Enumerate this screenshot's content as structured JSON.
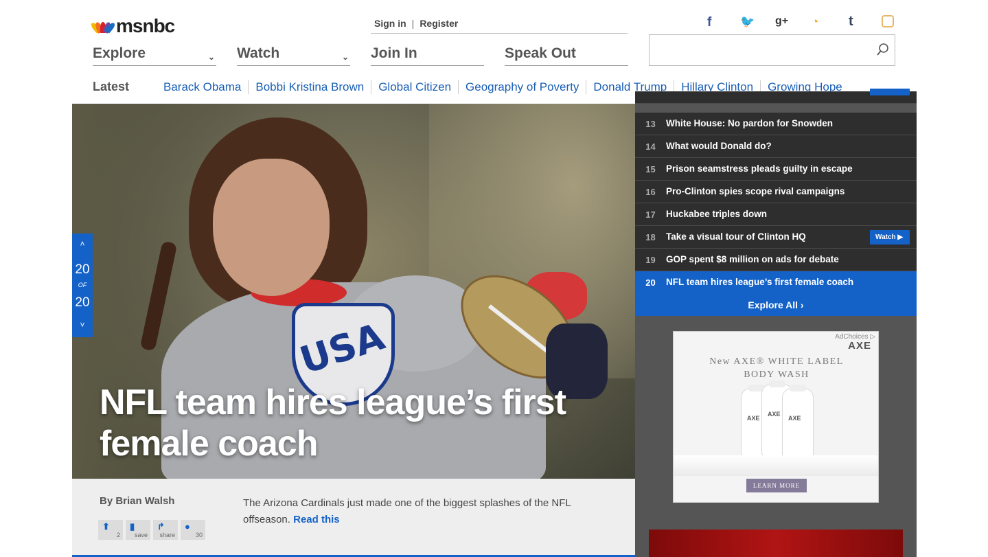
{
  "header": {
    "logo_text": "msnbc",
    "account": {
      "sign_in": "Sign in",
      "separator": "|",
      "register": "Register"
    },
    "nav": [
      {
        "label": "Explore",
        "has_dropdown": true
      },
      {
        "label": "Watch",
        "has_dropdown": true
      },
      {
        "label": "Join In",
        "has_dropdown": false
      },
      {
        "label": "Speak Out",
        "has_dropdown": false
      }
    ],
    "social": [
      "facebook-icon",
      "twitter-icon",
      "google-plus-icon",
      "rss-icon",
      "tumblr-icon",
      "instagram-icon"
    ],
    "search": {
      "value": "",
      "placeholder": ""
    }
  },
  "latest": {
    "label": "Latest",
    "links": [
      "Barack Obama",
      "Bobbi Kristina Brown",
      "Global Citizen",
      "Geography of Poverty",
      "Donald Trump",
      "Hillary Clinton",
      "Growing Hope"
    ]
  },
  "hero": {
    "headline": "NFL team hires league’s first female coach",
    "pager": {
      "up": "˄",
      "current": "20",
      "of": "OF",
      "total": "20",
      "down": "˅"
    },
    "byline": "By Brian Walsh",
    "summary": "The Arizona Cardinals just made one of the biggest splashes of the NFL offseason.",
    "read_link": "Read this",
    "actions": [
      {
        "icon": "upvote-icon",
        "glyph": "⬆",
        "label": "2"
      },
      {
        "icon": "bookmark-icon",
        "glyph": "▮",
        "label": "save"
      },
      {
        "icon": "share-icon",
        "glyph": "↱",
        "label": "share"
      },
      {
        "icon": "comment-icon",
        "glyph": "●",
        "label": "30"
      }
    ]
  },
  "sidebar": {
    "stories": [
      {
        "num": "13",
        "title": "White House: No pardon for Snowden",
        "watch": ""
      },
      {
        "num": "14",
        "title": "What would Donald do?",
        "watch": ""
      },
      {
        "num": "15",
        "title": "Prison seamstress pleads guilty in escape",
        "watch": ""
      },
      {
        "num": "16",
        "title": "Pro-Clinton spies scope rival campaigns",
        "watch": ""
      },
      {
        "num": "17",
        "title": "Huckabee triples down",
        "watch": ""
      },
      {
        "num": "18",
        "title": "Take a visual tour of Clinton HQ",
        "watch": "Watch ▶"
      },
      {
        "num": "19",
        "title": "GOP spent $8 million on ads for debate",
        "watch": ""
      },
      {
        "num": "20",
        "title": "NFL team hires league’s first female coach",
        "watch": "",
        "active": true
      }
    ],
    "explore_all": "Explore All ›"
  },
  "ad": {
    "adchoices": "AdChoices ▷",
    "brand": "AXE",
    "headline_line1": "New AXE® WHITE LABEL",
    "headline_line2": "BODY WASH",
    "bottle_label": "AXE",
    "cta": "LEARN MORE"
  },
  "colors": {
    "accent": "#1462c8",
    "dark_panel": "#2e2e2e",
    "link": "#1a5fb4"
  }
}
